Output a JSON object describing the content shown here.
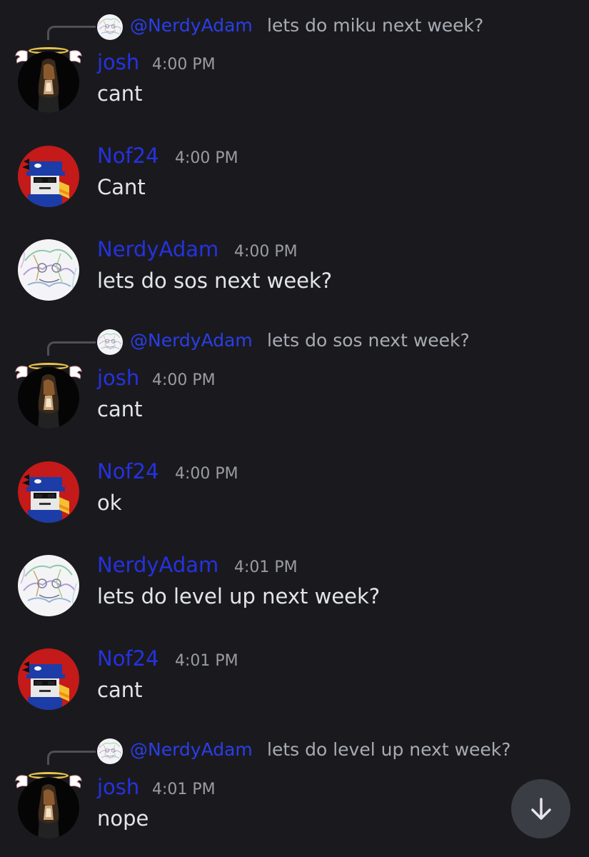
{
  "messages": [
    {
      "reply": {
        "mention": "@NerdyAdam",
        "text": "lets do miku next week?",
        "avatar_icon": "sketch-avatar-icon"
      },
      "author": "josh",
      "time": "4:00 PM",
      "body": "cant",
      "avatar_icon": "angel-avatar-icon"
    },
    {
      "author": "Nof24",
      "time": "4:00 PM",
      "body": "Cant",
      "avatar_icon": "mail-carrier-avatar-icon"
    },
    {
      "author": "NerdyAdam",
      "time": "4:00 PM",
      "body": "lets do sos next week?",
      "avatar_icon": "sketch-avatar-icon"
    },
    {
      "reply": {
        "mention": "@NerdyAdam",
        "text": "lets do sos next week?",
        "avatar_icon": "sketch-avatar-icon"
      },
      "author": "josh",
      "time": "4:00 PM",
      "body": "cant",
      "avatar_icon": "angel-avatar-icon"
    },
    {
      "author": "Nof24",
      "time": "4:00 PM",
      "body": "ok",
      "avatar_icon": "mail-carrier-avatar-icon"
    },
    {
      "author": "NerdyAdam",
      "time": "4:01 PM",
      "body": "lets do level up next week?",
      "avatar_icon": "sketch-avatar-icon"
    },
    {
      "author": "Nof24",
      "time": "4:01 PM",
      "body": "cant",
      "avatar_icon": "mail-carrier-avatar-icon"
    },
    {
      "reply": {
        "mention": "@NerdyAdam",
        "text": "lets do level up next week?",
        "avatar_icon": "sketch-avatar-icon"
      },
      "author": "josh",
      "time": "4:01 PM",
      "body": "nope",
      "avatar_icon": "angel-avatar-icon"
    }
  ],
  "scroll_button": {
    "icon": "arrow-down-icon"
  },
  "colors": {
    "background": "#1a1a1e",
    "author_name": "#2532e0",
    "mention": "#2a3ee8",
    "timestamp": "#9a9ca3",
    "message_text": "#e3e5e8",
    "reply_text": "#a8abb3",
    "scroll_button_bg": "#3b3d44"
  }
}
